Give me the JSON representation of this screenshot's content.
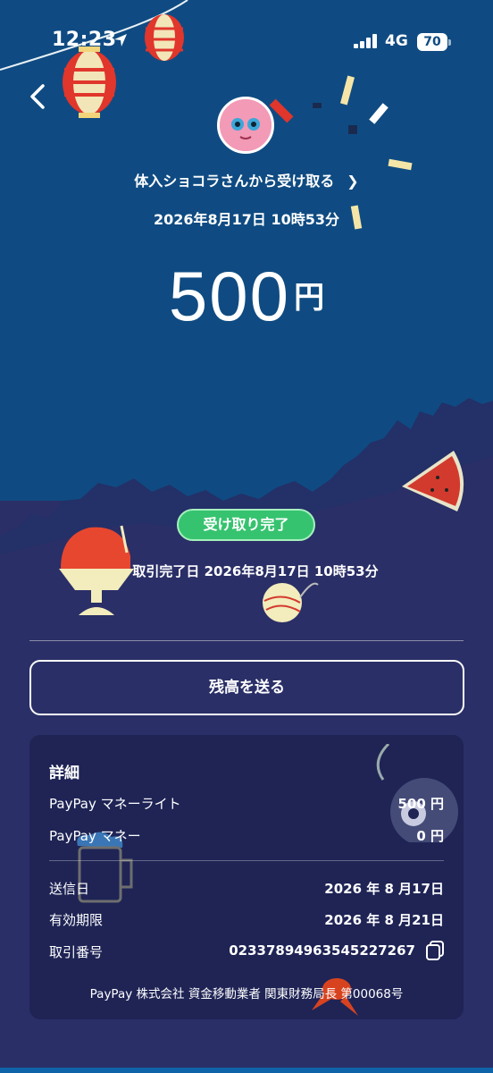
{
  "status_bar": {
    "time": "12:23",
    "network": "4G",
    "battery": "70"
  },
  "receive": {
    "sender_text": "体入ショコラさんから受け取る",
    "datetime": "2026年8月17日 10時53分",
    "amount": "500",
    "currency": "円"
  },
  "status": {
    "badge": "受け取り完了",
    "complete_date": "取引完了日 2026年8月17日 10時53分"
  },
  "actions": {
    "send_balance": "残高を送る"
  },
  "details": {
    "title": "詳細",
    "rows": [
      {
        "label": "PayPay マネーライト",
        "value": "500 円"
      },
      {
        "label": "PayPay マネー",
        "value": "0 円"
      }
    ],
    "info": [
      {
        "label": "送信日",
        "value": "2026 年 8 月17日"
      },
      {
        "label": "有効期限",
        "value": "2026 年 8 月21日"
      },
      {
        "label": "取引番号",
        "value": "02337894963545227267"
      }
    ],
    "footer": "PayPay 株式会社 資金移動業者 関東財務局長 第00068号"
  },
  "colors": {
    "background_top": "#0f4b82",
    "background_bottom": "#2a2f67",
    "badge_green": "#36c36f",
    "card": "#1f2455"
  },
  "icons": [
    "location-arrow-icon",
    "signal-icon",
    "back-chevron-icon",
    "chevron-right-icon",
    "copy-icon"
  ]
}
